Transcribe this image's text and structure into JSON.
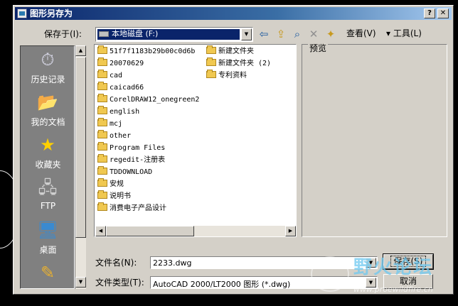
{
  "window": {
    "title": "图形另存为",
    "help_glyph": "?",
    "close_glyph": "✕"
  },
  "toolbar": {
    "save_in_label": "保存于(I):",
    "save_in_value": "本地磁盘 (F:)",
    "back_icon": "back-arrow-icon",
    "up_icon": "up-folder-icon",
    "search_icon": "search-web-icon",
    "delete_icon": "delete-icon",
    "new_folder_icon": "new-folder-icon",
    "views_label": "查看(V)",
    "tools_label": "▾ 工具(L)",
    "arrow": "▼"
  },
  "places": [
    {
      "label": "历史记录",
      "icon": "history-icon",
      "glyph": "⏱"
    },
    {
      "label": "我的文档",
      "icon": "my-documents-icon",
      "glyph": "📂"
    },
    {
      "label": "收藏夹",
      "icon": "favorites-star-icon",
      "glyph": "★"
    },
    {
      "label": "FTP",
      "icon": "ftp-icon",
      "glyph": "🖧"
    },
    {
      "label": "桌面",
      "icon": "desktop-icon",
      "glyph": "🖥"
    },
    {
      "label": "",
      "icon": "folder-pen-icon",
      "glyph": "✎"
    }
  ],
  "files_col1": [
    "51f7f1183b29b00c0d6b",
    "20070629",
    "cad",
    "caicad66",
    "CorelDRAW12_onegreen2",
    "english",
    "mcj",
    "other",
    "Program Files",
    "regedit-注册表",
    "TDDOWNLOAD",
    "安规",
    "说明书",
    "消费电子产品设计"
  ],
  "files_col2": [
    "新建文件夹",
    "新建文件夹 (2)",
    "专利资料"
  ],
  "preview_label": "预览",
  "filename": {
    "label": "文件名(N):",
    "value": "2233.dwg"
  },
  "filetype": {
    "label": "文件类型(T):",
    "value": "AutoCAD 2000/LT2000 图形 (*.dwg)"
  },
  "buttons": {
    "save": "保存(S)",
    "cancel": "取消"
  },
  "scroll": {
    "up": "▲",
    "down": "▼",
    "left": "◀",
    "right": "▶"
  },
  "watermark": {
    "title": "野火论坛",
    "url": "www.proewildfire.cn"
  }
}
